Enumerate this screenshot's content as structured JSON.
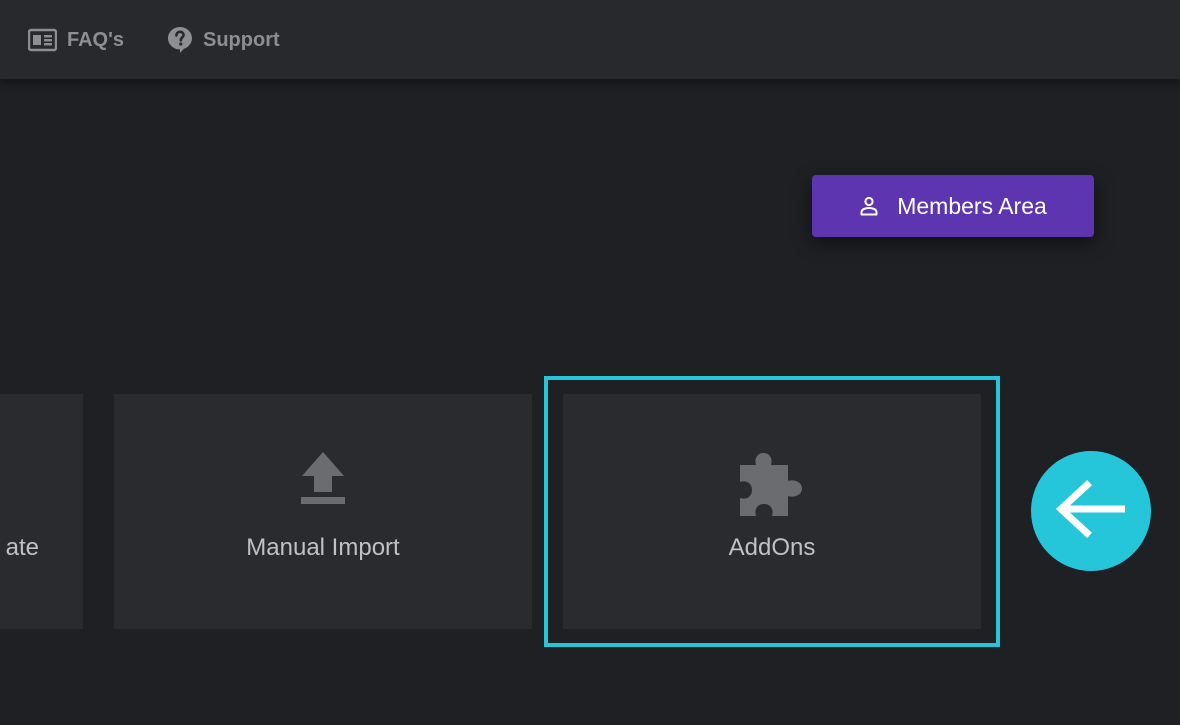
{
  "nav": {
    "faq_label": "FAQ's",
    "support_label": "Support"
  },
  "members_button": {
    "label": "Members Area"
  },
  "cards": {
    "update_label": "ate",
    "manual_import_label": "Manual Import",
    "addons_label": "AddOns"
  },
  "icons": {
    "faq": "newspaper-icon",
    "support": "help-bubble-icon",
    "members": "person-icon",
    "manual_import": "upload-icon",
    "addons": "puzzle-piece-icon",
    "callout": "arrow-left-icon"
  },
  "colors": {
    "background": "#1f2023",
    "topbar": "#28292c",
    "card": "#2a2b2f",
    "accent_purple": "#5e35b1",
    "highlight_cyan": "#26c6da"
  }
}
